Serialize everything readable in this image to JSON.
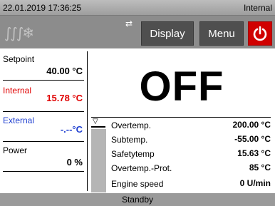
{
  "topbar": {
    "datetime": "22.01.2019 17:36:25",
    "source": "Internal"
  },
  "toolbar": {
    "heating_icon": "heating-icon",
    "usb_icon": "usb-icon",
    "display_label": "Display",
    "menu_label": "Menu",
    "power_icon": "power-icon"
  },
  "left": {
    "setpoint": {
      "label": "Setpoint",
      "value": "40.00 °C"
    },
    "internal": {
      "label": "Internal",
      "value": "15.78 °C",
      "color": "#e00000"
    },
    "external": {
      "label": "External",
      "value": "-.--°C",
      "color": "#1f3fd0"
    },
    "power": {
      "label": "Power",
      "value": "0 %"
    }
  },
  "main": {
    "state": "OFF"
  },
  "params": [
    {
      "name": "Overtemp.",
      "value": "200.00 °C"
    },
    {
      "name": "Subtemp.",
      "value": "-55.00 °C"
    },
    {
      "name": "Safetytemp",
      "value": "15.63 °C"
    },
    {
      "name": "Overtemp.-Prot.",
      "value": "85 °C"
    },
    {
      "name": "Engine speed",
      "value": "0 U/min"
    }
  ],
  "status": "Standby"
}
